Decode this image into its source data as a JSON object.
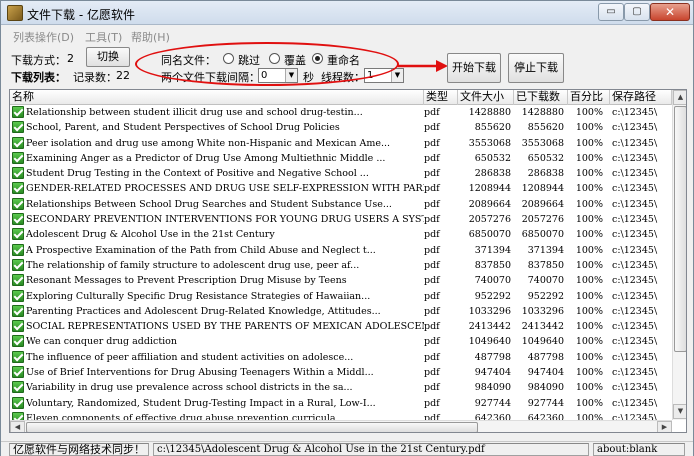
{
  "window": {
    "title": "文件下载 - 亿愿软件",
    "min_glyph": "▭",
    "max_glyph": "▢",
    "close_glyph": "✕"
  },
  "menu": {
    "list_ops": "列表操作(D)",
    "tools": "工具(T)",
    "help": "帮助(H)"
  },
  "controls": {
    "download_mode_label": "下载方式：",
    "download_mode_value": "2",
    "switch_button": "切换",
    "download_list_label": "下载列表：",
    "record_count_label": "记录数：",
    "record_count_value": "22",
    "same_name_label": "同名文件：",
    "option_skip": "跳过",
    "option_overwrite": "覆盖",
    "option_rename": "重命名",
    "selected_option": "rename",
    "interval_label": "两个文件下载间隔：",
    "interval_value": "0",
    "seconds_label": "秒",
    "threads_label": "线程数：",
    "threads_value": "1",
    "start_button": "开始下载",
    "stop_button": "停止下载"
  },
  "table": {
    "columns": {
      "name": "名称",
      "type": "类型",
      "size": "文件大小",
      "downloaded": "已下载数",
      "percent": "百分比",
      "path": "保存路径"
    },
    "rows": [
      {
        "name": "Relationship between student illicit drug use and school drug-testin...",
        "type": "pdf",
        "size": "1428880",
        "downloaded": "1428880",
        "percent": "100%",
        "path": "c:\\12345\\"
      },
      {
        "name": "School, Parent, and Student Perspectives of School Drug Policies",
        "type": "pdf",
        "size": "855620",
        "downloaded": "855620",
        "percent": "100%",
        "path": "c:\\12345\\"
      },
      {
        "name": "Peer isolation and drug use among White non-Hispanic and Mexican Ame...",
        "type": "pdf",
        "size": "3553068",
        "downloaded": "3553068",
        "percent": "100%",
        "path": "c:\\12345\\"
      },
      {
        "name": "Examining Anger as a Predictor of Drug Use Among Multiethnic Middle ...",
        "type": "pdf",
        "size": "650532",
        "downloaded": "650532",
        "percent": "100%",
        "path": "c:\\12345\\"
      },
      {
        "name": "Student Drug Testing in the Context of Positive and Negative School ...",
        "type": "pdf",
        "size": "286838",
        "downloaded": "286838",
        "percent": "100%",
        "path": "c:\\12345\\"
      },
      {
        "name": "GENDER-RELATED PROCESSES AND DRUG USE SELF-EXPRESSION WITH PARENTS, ...",
        "type": "pdf",
        "size": "1208944",
        "downloaded": "1208944",
        "percent": "100%",
        "path": "c:\\12345\\"
      },
      {
        "name": "Relationships Between School Drug Searches and Student Substance Use...",
        "type": "pdf",
        "size": "2089664",
        "downloaded": "2089664",
        "percent": "100%",
        "path": "c:\\12345\\"
      },
      {
        "name": "SECONDARY PREVENTION INTERVENTIONS FOR YOUNG DRUG USERS A SYSTEMATIC...",
        "type": "pdf",
        "size": "2057276",
        "downloaded": "2057276",
        "percent": "100%",
        "path": "c:\\12345\\"
      },
      {
        "name": "Adolescent Drug & Alcohol Use in the 21st Century",
        "type": "pdf",
        "size": "6850070",
        "downloaded": "6850070",
        "percent": "100%",
        "path": "c:\\12345\\"
      },
      {
        "name": "A Prospective Examination of the Path from Child Abuse and Neglect t...",
        "type": "pdf",
        "size": "371394",
        "downloaded": "371394",
        "percent": "100%",
        "path": "c:\\12345\\"
      },
      {
        "name": "The relationship of family structure to adolescent drug use, peer af...",
        "type": "pdf",
        "size": "837850",
        "downloaded": "837850",
        "percent": "100%",
        "path": "c:\\12345\\"
      },
      {
        "name": "Resonant Messages to Prevent Prescription Drug Misuse by Teens",
        "type": "pdf",
        "size": "740070",
        "downloaded": "740070",
        "percent": "100%",
        "path": "c:\\12345\\"
      },
      {
        "name": "Exploring Culturally Specific Drug Resistance Strategies of Hawaiian...",
        "type": "pdf",
        "size": "952292",
        "downloaded": "952292",
        "percent": "100%",
        "path": "c:\\12345\\"
      },
      {
        "name": "Parenting Practices and Adolescent Drug-Related Knowledge, Attitudes...",
        "type": "pdf",
        "size": "1033296",
        "downloaded": "1033296",
        "percent": "100%",
        "path": "c:\\12345\\"
      },
      {
        "name": "SOCIAL REPRESENTATIONS USED BY THE PARENTS OF MEXICAN ADOLESCENT DRU...",
        "type": "pdf",
        "size": "2413442",
        "downloaded": "2413442",
        "percent": "100%",
        "path": "c:\\12345\\"
      },
      {
        "name": "We can conquer drug addiction",
        "type": "pdf",
        "size": "1049640",
        "downloaded": "1049640",
        "percent": "100%",
        "path": "c:\\12345\\"
      },
      {
        "name": "The influence of peer affiliation and student activities on adolesce...",
        "type": "pdf",
        "size": "487798",
        "downloaded": "487798",
        "percent": "100%",
        "path": "c:\\12345\\"
      },
      {
        "name": "Use of Brief Interventions for Drug Abusing Teenagers Within a Middl...",
        "type": "pdf",
        "size": "947404",
        "downloaded": "947404",
        "percent": "100%",
        "path": "c:\\12345\\"
      },
      {
        "name": "Variability in drug use prevalence across school districts in the sa...",
        "type": "pdf",
        "size": "984090",
        "downloaded": "984090",
        "percent": "100%",
        "path": "c:\\12345\\"
      },
      {
        "name": "Voluntary, Randomized, Student Drug-Testing Impact in a Rural, Low-I...",
        "type": "pdf",
        "size": "927744",
        "downloaded": "927744",
        "percent": "100%",
        "path": "c:\\12345\\"
      },
      {
        "name": "Eleven components of effective drug abuse prevention curricula",
        "type": "pdf",
        "size": "642360",
        "downloaded": "642360",
        "percent": "100%",
        "path": "c:\\12345\\"
      }
    ]
  },
  "scroll": {
    "up": "▲",
    "down": "▼",
    "left": "◀",
    "right": "▶",
    "grip": "|||"
  },
  "status": {
    "left": "亿愿软件与网络技术同步！",
    "middle": "c:\\12345\\Adolescent Drug & Alcohol Use in the 21st Century.pdf",
    "right": "about:blank"
  },
  "colors": {
    "highlight": "#e01010",
    "check": "#2a8a24"
  },
  "icons": {
    "row_status": "green-check-icon",
    "app": "app-icon"
  }
}
